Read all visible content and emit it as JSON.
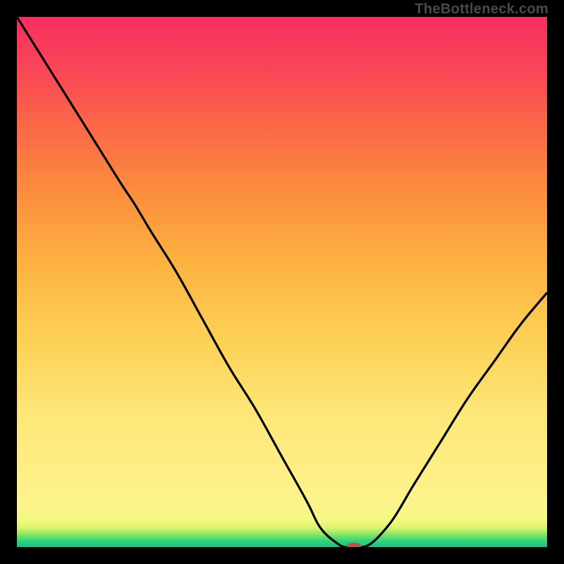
{
  "watermark": "TheBottleneck.com",
  "colors": {
    "frame": "#000000",
    "curve": "#000000",
    "marker": "#c2504e"
  },
  "chart_data": {
    "type": "line",
    "title": "",
    "xlabel": "",
    "ylabel": "",
    "xlim": [
      0,
      100
    ],
    "ylim": [
      0,
      100
    ],
    "grid": false,
    "x": [
      0,
      5,
      10,
      15,
      20,
      22,
      25,
      30,
      35,
      40,
      45,
      50,
      55,
      57,
      60,
      62,
      65,
      70,
      75,
      80,
      85,
      90,
      95,
      100
    ],
    "values": [
      100,
      92,
      84,
      76,
      68,
      65,
      60,
      52,
      43,
      34,
      26,
      17,
      8,
      4,
      1,
      0,
      0,
      4,
      12,
      20,
      28,
      35,
      42,
      48
    ],
    "marker": {
      "x": 63.5,
      "y": 0
    },
    "annotations": []
  }
}
